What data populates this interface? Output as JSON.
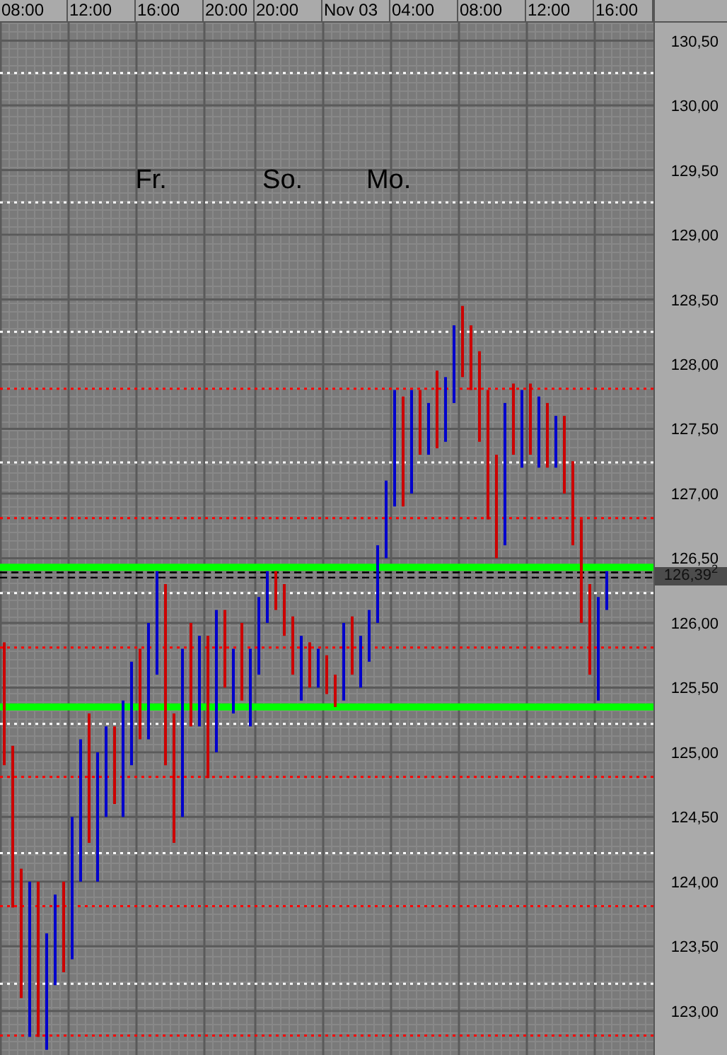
{
  "time_axis": {
    "labels": [
      "08:00",
      "12:00",
      "16:00",
      "20:00",
      "20:00",
      "Nov 03",
      "04:00",
      "08:00",
      "12:00",
      "16:00"
    ]
  },
  "price_axis": {
    "labels": [
      "130,50",
      "130,00",
      "129,50",
      "129,00",
      "128,50",
      "128,00",
      "127,50",
      "127,00",
      "126,50",
      "126,00",
      "125,50",
      "125,00",
      "124,50",
      "124,00",
      "123,50",
      "123,00"
    ]
  },
  "day_labels": [
    "Fr.",
    "So.",
    "Mo."
  ],
  "price_tag": {
    "text": "126,39$^{2}$"
  }
}
